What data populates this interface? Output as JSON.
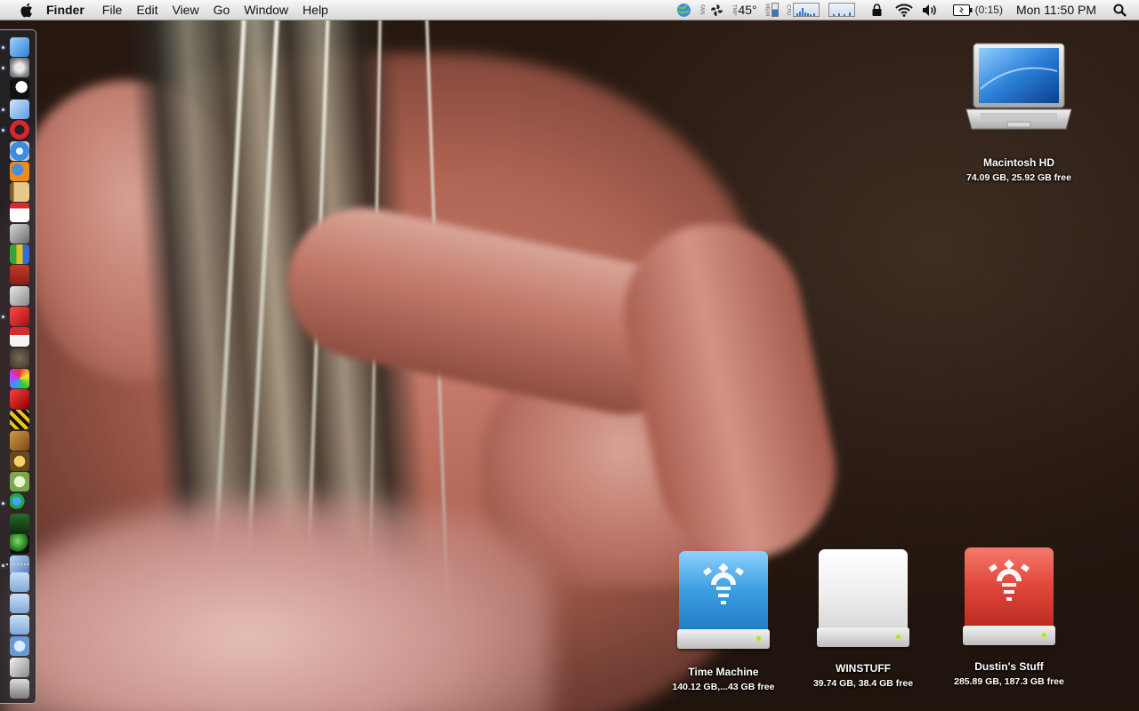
{
  "menubar": {
    "app_name": "Finder",
    "menus": [
      "File",
      "Edit",
      "View",
      "Go",
      "Window",
      "Help"
    ],
    "temperature": "45°",
    "sensor_labels": {
      "fan": "FAN",
      "temp": "TMP",
      "mem": "MEM",
      "cpu": "CPU"
    },
    "battery_time": "(0:15)",
    "clock": "Mon 11:50 PM"
  },
  "desktop_icons": [
    {
      "name": "Macintosh HD",
      "info": "74.09 GB, 25.92 GB free",
      "kind": "laptop"
    },
    {
      "name": "Time Machine",
      "info": "140.12 GB,...43 GB free",
      "kind": "firewire-drive",
      "color": "#3d9fe0"
    },
    {
      "name": "WINSTUFF",
      "info": "39.74 GB, 38.4 GB free",
      "kind": "drive",
      "color": "#f4f4f4"
    },
    {
      "name": "Dustin's Stuff",
      "info": "285.89 GB, 187.3 GB free",
      "kind": "firewire-drive",
      "color": "#e0473a"
    }
  ],
  "dock": {
    "orientation": "left",
    "items": [
      {
        "icon": "finder-icon",
        "running": true
      },
      {
        "icon": "system-preferences-icon",
        "running": true
      },
      {
        "icon": "camino-icon",
        "running": false
      },
      {
        "icon": "preview-icon",
        "running": true
      },
      {
        "icon": "opera-icon",
        "running": true
      },
      {
        "icon": "safari-icon",
        "running": false
      },
      {
        "icon": "firefox-icon",
        "running": false
      },
      {
        "icon": "address-book-icon",
        "running": false
      },
      {
        "icon": "ical-icon",
        "running": false
      },
      {
        "icon": "script-editor-icon",
        "running": false
      },
      {
        "icon": "activity-monitor-icon",
        "running": false
      },
      {
        "icon": "photo-booth-icon",
        "running": false
      },
      {
        "icon": "chess-icon",
        "running": false
      },
      {
        "icon": "flash-icon",
        "running": true
      },
      {
        "icon": "calendar-1917-icon",
        "running": false
      },
      {
        "icon": "gimp-icon",
        "running": false
      },
      {
        "icon": "color-picker-icon",
        "running": false
      },
      {
        "icon": "imovie-icon",
        "running": false
      },
      {
        "icon": "clapper-icon",
        "running": false
      },
      {
        "icon": "guitar-icon",
        "running": false
      },
      {
        "icon": "garageband-icon",
        "running": false
      },
      {
        "icon": "script-f-icon",
        "running": false
      },
      {
        "icon": "messenger-icon",
        "running": true
      },
      {
        "icon": "utility-icon",
        "running": false
      },
      {
        "icon": "green-orb-icon",
        "running": false
      },
      {
        "icon": "iphoto-icon",
        "running": true
      }
    ],
    "stack_items": [
      {
        "icon": "applications-folder-icon"
      },
      {
        "icon": "documents-folder-icon"
      },
      {
        "icon": "downloads-folder-icon"
      },
      {
        "icon": "network-folder-icon"
      },
      {
        "icon": "pictures-stack-icon"
      },
      {
        "icon": "trash-icon"
      }
    ]
  }
}
